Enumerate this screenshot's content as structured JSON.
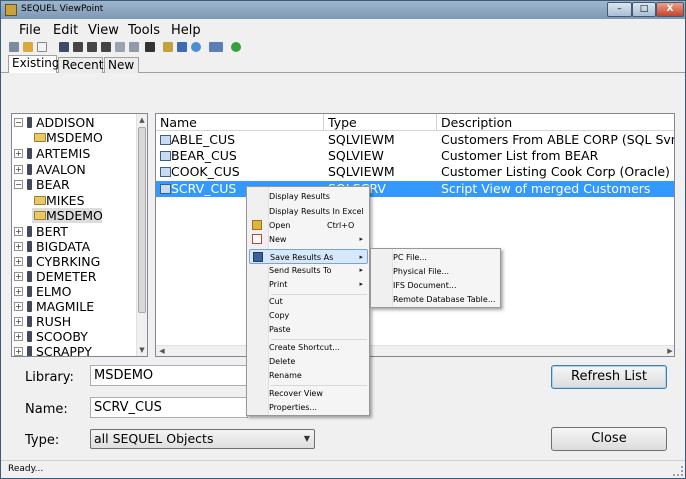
{
  "window": {
    "title": "SEQUEL ViewPoint",
    "minimize": "–",
    "maximize": "□",
    "close": "X"
  },
  "menu": [
    "File",
    "Edit",
    "View",
    "Tools",
    "Help"
  ],
  "tabs": [
    "Existing",
    "Recent",
    "New"
  ],
  "tree": {
    "items": [
      {
        "label": "ADDISON",
        "kind": "server",
        "expand": "−"
      },
      {
        "label": "MSDEMO",
        "kind": "library"
      },
      {
        "label": "ARTEMIS",
        "kind": "server",
        "expand": "+"
      },
      {
        "label": "AVALON",
        "kind": "server",
        "expand": "+"
      },
      {
        "label": "BEAR",
        "kind": "server",
        "expand": "−"
      },
      {
        "label": "MIKES",
        "kind": "library"
      },
      {
        "label": "MSDEMO",
        "kind": "library"
      },
      {
        "label": "BERT",
        "kind": "server",
        "expand": "+"
      },
      {
        "label": "BIGDATA",
        "kind": "server",
        "expand": "+"
      },
      {
        "label": "CYBRKING",
        "kind": "server",
        "expand": "+"
      },
      {
        "label": "DEMETER",
        "kind": "server",
        "expand": "+"
      },
      {
        "label": "ELMO",
        "kind": "server",
        "expand": "+"
      },
      {
        "label": "MAGMILE",
        "kind": "server",
        "expand": "+"
      },
      {
        "label": "RUSH",
        "kind": "server",
        "expand": "+"
      },
      {
        "label": "SCOOBY",
        "kind": "server",
        "expand": "+"
      },
      {
        "label": "SCRAPPY",
        "kind": "server",
        "expand": "+"
      }
    ]
  },
  "list": {
    "columns": [
      "Name",
      "Type",
      "Description"
    ],
    "rows": [
      {
        "name": "ABLE_CUS",
        "type": "SQLVIEWM",
        "description": "Customers From ABLE CORP (SQL Svr)"
      },
      {
        "name": "BEAR_CUS",
        "type": "SQLVIEW",
        "description": "Customer List from BEAR"
      },
      {
        "name": "COOK_CUS",
        "type": "SQLVIEWM",
        "description": "Customer Listing Cook Corp (Oracle)"
      },
      {
        "name": "SCRV_CUS",
        "type": "SQLSCRV",
        "description": "Script View of merged Customers"
      }
    ]
  },
  "form": {
    "library_label": "Library:",
    "library_value": "MSDEMO",
    "name_label": "Name:",
    "name_value": "SCRV_CUS",
    "type_label": "Type:",
    "type_value": "all SEQUEL Objects"
  },
  "buttons": {
    "refresh": "Refresh List",
    "close": "Close"
  },
  "status": "Ready...",
  "context_menu": {
    "items": [
      {
        "label": "Display Results"
      },
      {
        "label": "Display Results In Excel"
      },
      {
        "label": "Open",
        "shortcut": "Ctrl+O"
      },
      {
        "label": "New"
      },
      {
        "label": "Save Results As"
      },
      {
        "label": "Send Results To"
      },
      {
        "label": "Print"
      },
      {
        "label": "Cut"
      },
      {
        "label": "Copy"
      },
      {
        "label": "Paste"
      },
      {
        "label": "Create Shortcut..."
      },
      {
        "label": "Delete"
      },
      {
        "label": "Rename"
      },
      {
        "label": "Recover View"
      },
      {
        "label": "Properties..."
      }
    ],
    "submenu_arrow": "▸"
  },
  "submenu": {
    "items": [
      "PC File...",
      "Physical File...",
      "IFS Document...",
      "Remote Database Table..."
    ]
  },
  "colors": {
    "selection": "#3399ff",
    "title_bar": "#8aa4be",
    "close_button": "#c4442b"
  }
}
